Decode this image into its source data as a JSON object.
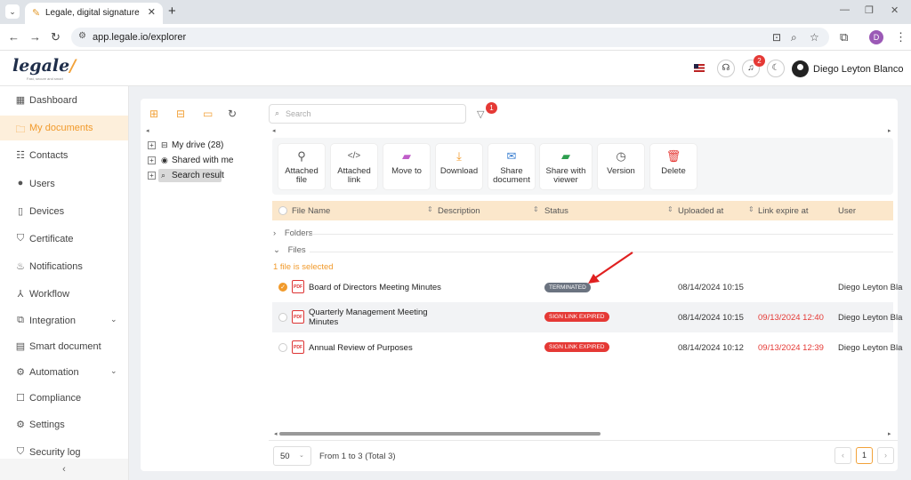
{
  "browser": {
    "tab_title": "Legale, digital signature",
    "url": "app.legale.io/explorer",
    "profile_initial": "D"
  },
  "header": {
    "logo_text": "legale",
    "logo_tagline": "Fast, secure and smart",
    "notification_count": "2",
    "user_name": "Diego Leyton Blanco"
  },
  "sidebar": {
    "items": [
      {
        "label": "Dashboard",
        "icon": "dashboard-icon",
        "glyph": "▦"
      },
      {
        "label": "My documents",
        "icon": "folder-icon",
        "glyph": "🗀"
      },
      {
        "label": "Contacts",
        "icon": "contacts-icon",
        "glyph": "☷"
      },
      {
        "label": "Users",
        "icon": "user-icon",
        "glyph": "●"
      },
      {
        "label": "Devices",
        "icon": "device-icon",
        "glyph": "▯"
      },
      {
        "label": "Certificate",
        "icon": "shield-icon",
        "glyph": "⛉"
      },
      {
        "label": "Notifications",
        "icon": "notification-icon",
        "glyph": "♨"
      },
      {
        "label": "Workflow",
        "icon": "workflow-icon",
        "glyph": "⅄"
      },
      {
        "label": "Integration",
        "icon": "integration-icon",
        "glyph": "⧉"
      },
      {
        "label": "Smart document",
        "icon": "smart-document-icon",
        "glyph": "▤"
      },
      {
        "label": "Automation",
        "icon": "automation-icon",
        "glyph": "⚙"
      },
      {
        "label": "Compliance",
        "icon": "compliance-icon",
        "glyph": "☐"
      },
      {
        "label": "Settings",
        "icon": "gear-icon",
        "glyph": "⚙"
      },
      {
        "label": "Security log",
        "icon": "security-log-icon",
        "glyph": "⛉"
      }
    ],
    "collapse_glyph": "‹"
  },
  "tree": {
    "my_drive": "My drive (28)",
    "shared": "Shared with me",
    "search_result": "Search result"
  },
  "search": {
    "placeholder": "Search",
    "filter_count": "1"
  },
  "actions": [
    {
      "label": "Attached file",
      "icon": "paperclip-icon",
      "glyph": "⚲"
    },
    {
      "label": "Attached link",
      "icon": "code-link-icon",
      "glyph": "</>"
    },
    {
      "label": "Move to",
      "icon": "move-folder-icon",
      "glyph": "▰"
    },
    {
      "label": "Download",
      "icon": "download-icon",
      "glyph": "⤓"
    },
    {
      "label": "Share document",
      "icon": "envelope-icon",
      "glyph": "✉"
    },
    {
      "label": "Share with viewer",
      "icon": "share-viewer-icon",
      "glyph": "▰"
    },
    {
      "label": "Version",
      "icon": "version-icon",
      "glyph": "◷"
    },
    {
      "label": "Delete",
      "icon": "trash-icon",
      "glyph": "🗑"
    }
  ],
  "table": {
    "headers": {
      "file_name": "File Name",
      "description": "Description",
      "status": "Status",
      "uploaded_at": "Uploaded at",
      "link_expire_at": "Link expire at",
      "user": "User"
    },
    "folders_label": "Folders",
    "files_label": "Files",
    "selected_note": "1 file is selected",
    "rows": [
      {
        "name_line1": "Board of Directors Meeting Minutes",
        "name_line2": "",
        "status": "TERMINATED",
        "uploaded_at": "08/14/2024 10:15",
        "link_expire_at": "",
        "user": "Diego Leyton Bla"
      },
      {
        "name_line1": "Quarterly Management Meeting",
        "name_line2": "Minutes",
        "status": "SIGN LINK EXPIRED",
        "uploaded_at": "08/14/2024 10:15",
        "link_expire_at": "09/13/2024 12:40",
        "user": "Diego Leyton Bla"
      },
      {
        "name_line1": "Annual Review of Purposes",
        "name_line2": "",
        "status": "SIGN LINK EXPIRED",
        "uploaded_at": "08/14/2024 10:12",
        "link_expire_at": "09/13/2024 12:39",
        "user": "Diego Leyton Bla"
      }
    ]
  },
  "footer": {
    "page_size": "50",
    "range_text": "From 1 to 3 (Total 3)",
    "current_page": "1"
  },
  "colors": {
    "accent": "#f19a2b",
    "header_row": "#fbe7cb",
    "status_terminated": "#6b7380",
    "status_expired": "#e53935"
  }
}
